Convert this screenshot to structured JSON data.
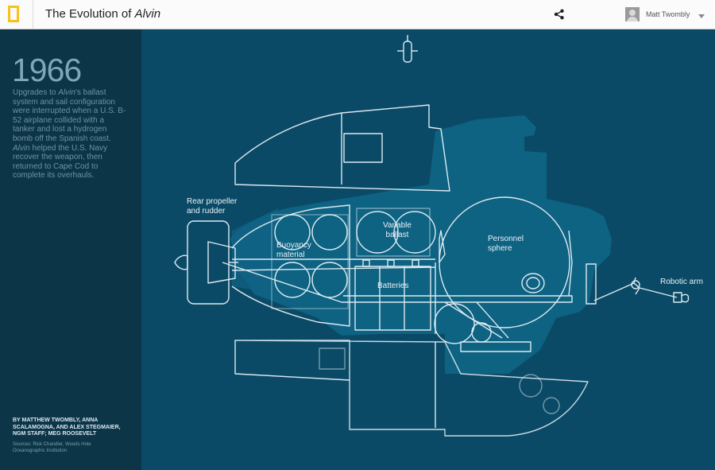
{
  "header": {
    "title_prefix": "The Evolution of ",
    "title_emphasis": "Alvin",
    "share_icon": "share-icon",
    "user_name": "Matt Twombly"
  },
  "sidebar": {
    "year": "1966",
    "description": {
      "p1": "Upgrades to ",
      "p2": "Alvin",
      "p3": "'s ballast system and sail configuration were interrupted when a U.S. B-52 airplane collided with a tanker and lost a hydrogen bomb off the Spanish coast. ",
      "p4": "Alvin",
      "p5": " helped the U.S. Navy recover the weapon, then returned to Cape Cod to complete its overhauls."
    },
    "byline": "By Matthew Twombly, Anna Scalamogna, and Alex Stegmaier, NGM Staff; Meg Roosevelt",
    "sources": "Sources: Rick Chandler, Woods Hole Oceanographic Institution"
  },
  "diagram": {
    "labels": {
      "rear_propeller": [
        "Rear propeller",
        "and rudder"
      ],
      "buoyancy": [
        "Buoyancy",
        "material"
      ],
      "variable_ballast": [
        "Variable",
        "ballast"
      ],
      "batteries": "Batteries",
      "personnel_sphere": [
        "Personnel",
        "sphere"
      ],
      "robotic_arm": "Robotic arm"
    },
    "colors": {
      "background": "#0b4a66",
      "sidebar": "#0c3548",
      "silhouette": "#0f6384",
      "outline": "#dbeaf1",
      "logo": "#f7c21a"
    }
  }
}
